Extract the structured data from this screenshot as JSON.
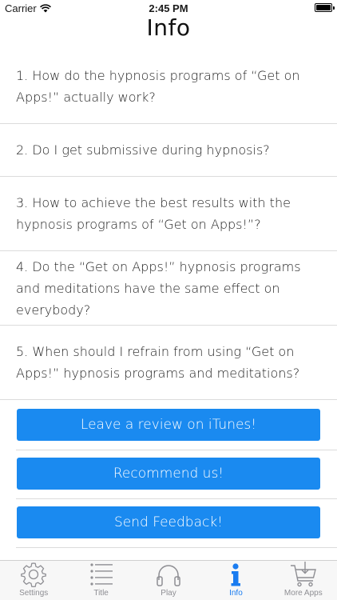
{
  "status_bar": {
    "carrier": "Carrier",
    "time": "2:45 PM"
  },
  "page": {
    "title": "Info"
  },
  "faq": [
    {
      "text": "1. How do the hypnosis programs of “Get on Apps!” actually work?"
    },
    {
      "text": "2.  Do I get submissive during hypnosis?"
    },
    {
      "text": "3. How to achieve the best results with the hypnosis programs of “Get on Apps!”?"
    },
    {
      "text": "4. Do the “Get on Apps!” hypnosis programs and meditations have the same effect on everybody?"
    },
    {
      "text": "5. When should I refrain from using “Get on Apps!” hypnosis programs and meditations?"
    }
  ],
  "buttons": {
    "review": "Leave a review on iTunes!",
    "recommend": "Recommend us!",
    "feedback": "Send Feedback!"
  },
  "tabs": [
    {
      "label": "Settings",
      "icon": "gear-icon",
      "active": false
    },
    {
      "label": "Title",
      "icon": "list-icon",
      "active": false
    },
    {
      "label": "Play",
      "icon": "headphones-icon",
      "active": false
    },
    {
      "label": "Info",
      "icon": "info-icon",
      "active": true
    },
    {
      "label": "More Apps",
      "icon": "cart-icon",
      "active": false
    }
  ],
  "colors": {
    "accent": "#1a8af0",
    "tab_active": "#1a7cf0",
    "tab_inactive": "#8e8e93"
  }
}
